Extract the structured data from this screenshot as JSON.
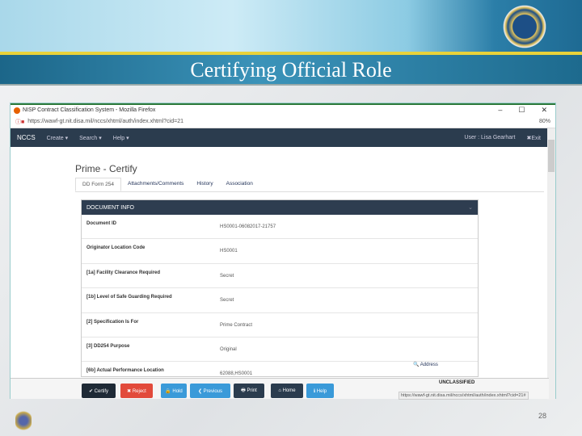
{
  "slide": {
    "title": "Certifying Official Role",
    "page_number": "28"
  },
  "browser": {
    "title": "NISP Contract Classification System - Mozilla Firefox",
    "url": "https://wawf-gt.nit.disa.mil/nccs/xhtml/auth/index.xhtml?cid=21",
    "zoom": "80%",
    "status_url": "https://wawf-gt.nit.disa.mil/nccs/xhtml/auth/index.xhtml?cid=21#",
    "controls": [
      "–",
      "☐",
      "✕"
    ]
  },
  "nav": {
    "brand": "NCCS",
    "items": [
      "Create ▾",
      "Search ▾",
      "Help ▾"
    ],
    "user": "User : Lisa Gearhart",
    "exit": "✖Exit"
  },
  "page": {
    "title": "Prime - Certify",
    "tabs": [
      "DD Form 254",
      "Attachments/Comments",
      "History",
      "Association"
    ],
    "panel_title": "DOCUMENT INFO",
    "rows": [
      {
        "label": "Document ID",
        "value": "HS0001-06082017-21757"
      },
      {
        "label": "Originator Location Code",
        "value": "HS0001"
      },
      {
        "label": "[1a] Facility Clearance Required",
        "value": "Secret"
      },
      {
        "label": "[1b] Level of Safe Guarding Required",
        "value": "Secret"
      },
      {
        "label": "[2] Specification Is For",
        "value": "Prime Contract"
      },
      {
        "label": "[3] DD254 Purpose",
        "value": "Original"
      },
      {
        "label": "[6b] Actual Performance Location",
        "value": "62088,HS0001",
        "action": "🔍 Address"
      }
    ]
  },
  "footer": {
    "classification": "UNCLASSIFIED",
    "buttons": [
      {
        "label": "✔ Certify",
        "color": "#1f2a36"
      },
      {
        "label": "✖ Reject",
        "color": "#e24a3b"
      },
      {
        "label": "🔒 Hold",
        "color": "#3a9ad9"
      },
      {
        "label": "❮ Previous",
        "color": "#3a9ad9"
      },
      {
        "label": "🖶 Print",
        "color": "#2b3c4e"
      },
      {
        "label": "⌂ Home",
        "color": "#2b3c4e"
      },
      {
        "label": "ℹ Help",
        "color": "#3a9ad9"
      }
    ]
  }
}
